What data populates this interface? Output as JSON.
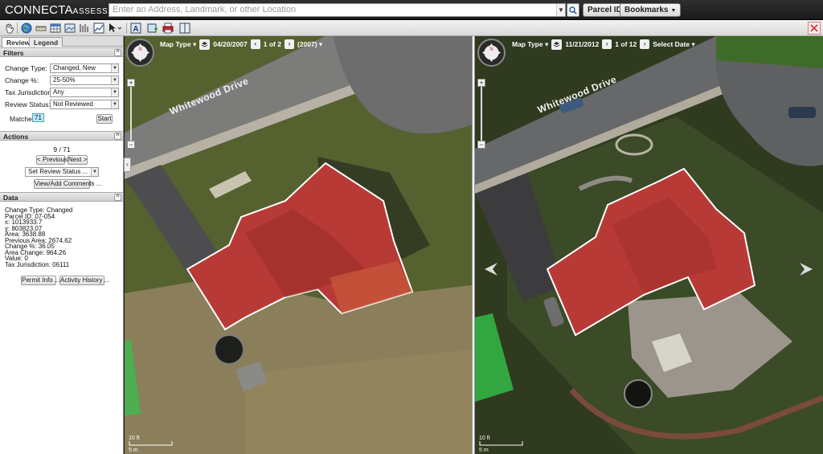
{
  "app": {
    "logo_main": "CONNECTA",
    "logo_sub": "SSESSMENT",
    "logo_tm": "™"
  },
  "search": {
    "placeholder": "Enter an Address, Landmark, or other Location"
  },
  "topmenus": {
    "parcel_id": "Parcel ID",
    "bookmarks": "Bookmarks"
  },
  "tabs": {
    "review": "Review",
    "legend": "Legend"
  },
  "filters": {
    "title": "Filters",
    "change_type_label": "Change Type:",
    "change_type_value": "Changed, New",
    "change_pct_label": "Change %:",
    "change_pct_value": "25-50%",
    "tax_jur_label": "Tax Jurisdiction:",
    "tax_jur_value": "Any",
    "review_status_label": "Review Status:",
    "review_status_value": "Not Reviewed",
    "matches_label": "Matches:",
    "matches_value": "71",
    "start_label": "Start"
  },
  "actions": {
    "title": "Actions",
    "counter": "9 / 71",
    "previous_label": "< Previous",
    "next_label": "Next >",
    "set_review_status": "Set Review Status ...",
    "view_add_comments": "View/Add Comments ..."
  },
  "data": {
    "title": "Data",
    "lines": [
      "Change Type: Changed",
      "Parcel ID: 07-054",
      "x: 1013933.7",
      "y: 803823.07",
      "Area: 3638.88",
      "Previous Area: 2674.62",
      "Change %: 36.05",
      "Area Change: 964.26",
      "Value: 0",
      "Tax Jurisdiction: 06111"
    ],
    "permit_info": "Permit Info ...",
    "activity_history": "Activity History ..."
  },
  "left_map": {
    "map_type": "Map Type",
    "date": "04/20/2007",
    "page": "1 of 2",
    "year": "(2007)",
    "street": "Whitewood Drive",
    "scale_ft": "10 ft",
    "scale_m": "5 m"
  },
  "right_map": {
    "map_type": "Map Type",
    "date": "11/21/2012",
    "page": "1 of 12",
    "select_date": "Select Date",
    "street": "Whitewood Drive",
    "scale_ft": "10 ft",
    "scale_m": "5 m"
  },
  "colors": {
    "parcel_fill": "#b83a36",
    "grass": "#5d6b3a",
    "dry_field": "#8f8260",
    "road": "#6f6f70",
    "highlight_green": "#33c24a"
  }
}
